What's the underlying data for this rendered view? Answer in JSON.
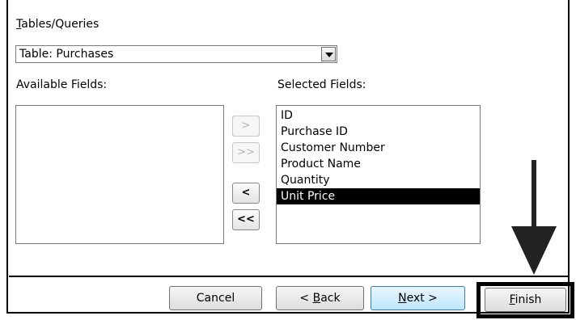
{
  "tables_queries": {
    "label_prefix": "T",
    "label_rest": "ables/Queries",
    "selected": "Table: Purchases"
  },
  "available": {
    "label": "Available Fields:",
    "items": []
  },
  "selected": {
    "label": "Selected Fields:",
    "items": [
      "ID",
      "Purchase ID",
      "Customer Number",
      "Product Name",
      "Quantity",
      "Unit Price"
    ],
    "highlighted": "Unit Price"
  },
  "move_buttons": {
    "add_one": ">",
    "add_all": ">>",
    "remove_one": "<",
    "remove_all": "<<"
  },
  "footer": {
    "cancel": "Cancel",
    "back_prefix": "< ",
    "back_key": "B",
    "back_rest": "ack",
    "next_key": "N",
    "next_rest": "ext >",
    "finish_key": "F",
    "finish_rest": "inish"
  }
}
